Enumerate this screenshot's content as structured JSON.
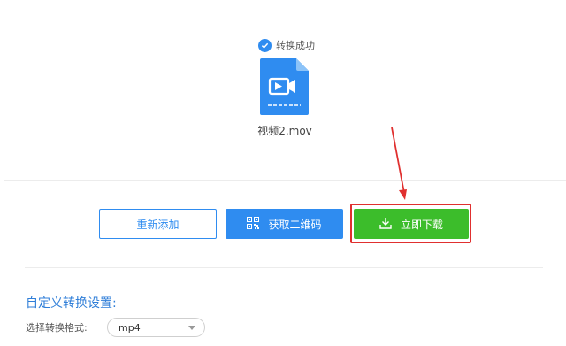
{
  "result": {
    "status_text": "转换成功",
    "file_name": "视频2.mov"
  },
  "actions": {
    "readd_label": "重新添加",
    "qr_label": "获取二维码",
    "download_label": "立即下载"
  },
  "settings": {
    "section_title": "自定义转换设置:",
    "format_label": "选择转换格式:",
    "format_value": "mp4"
  },
  "icons": {
    "status": "check-circle-icon",
    "file": "video-file-icon",
    "qr": "qr-code-icon",
    "download": "download-icon"
  },
  "colors": {
    "accent": "#2f8cf0",
    "success": "#3cbd2b",
    "annotation": "#e0302f"
  }
}
